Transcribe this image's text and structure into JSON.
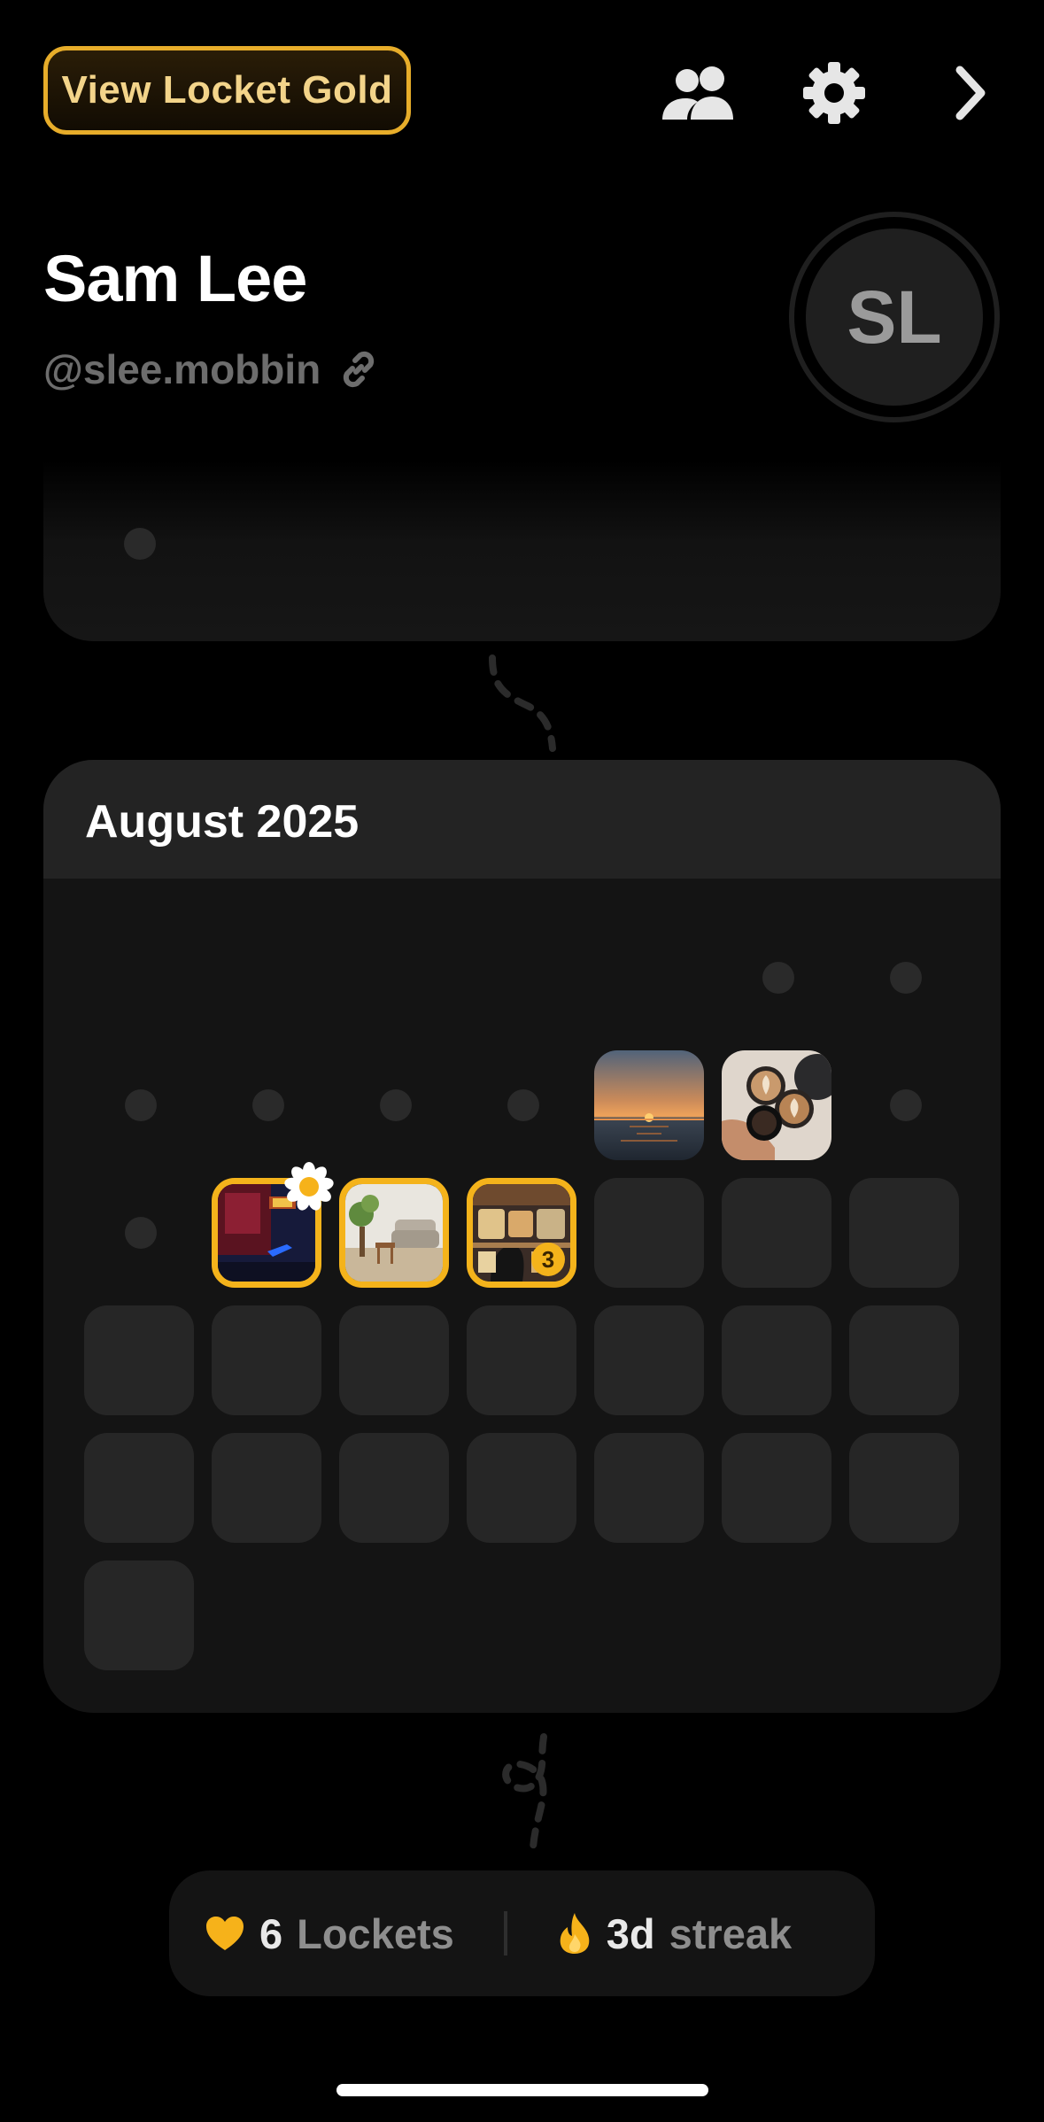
{
  "header": {
    "gold_button_label": "View Locket Gold",
    "icons": [
      "friends-icon",
      "gear-icon",
      "chevron-right-icon"
    ]
  },
  "profile": {
    "name": "Sam Lee",
    "handle": "@slee.mobbin",
    "avatar_initials": "SL"
  },
  "calendar": {
    "month_title": "August 2025",
    "photos": [
      {
        "name": "sunset-ocean"
      },
      {
        "name": "coffee-cups"
      },
      {
        "name": "gaming-desk",
        "has_flower_sticker": true
      },
      {
        "name": "living-room"
      },
      {
        "name": "food-display",
        "count": "3"
      }
    ]
  },
  "stats": {
    "lockets_count": "6",
    "lockets_label": "Lockets",
    "streak_value": "3d",
    "streak_label": "streak"
  },
  "colors": {
    "accent_gold": "#f4b31b",
    "background": "#000000",
    "card": "#141414",
    "empty_cell": "#262626"
  }
}
